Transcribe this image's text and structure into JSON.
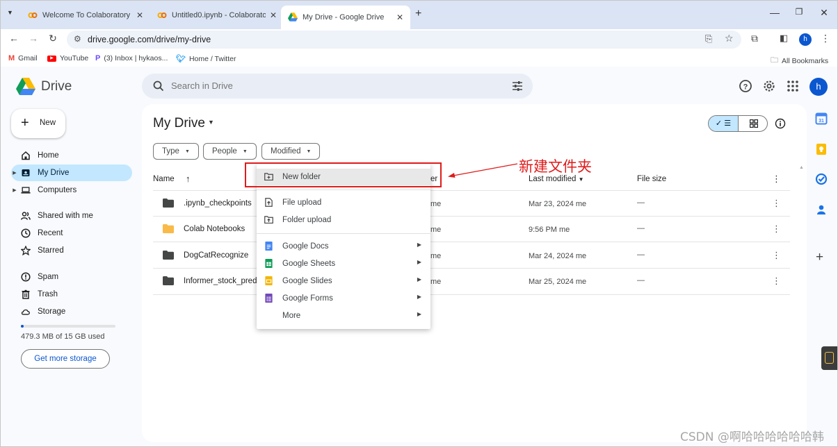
{
  "browser": {
    "tabs": [
      {
        "title": "Welcome To Colaboratory - C",
        "icon": "colab-icon",
        "active": false
      },
      {
        "title": "Untitled0.ipynb - Colaborato",
        "icon": "colab-icon",
        "active": false
      },
      {
        "title": "My Drive - Google Drive",
        "icon": "drive-icon",
        "active": true
      }
    ],
    "new_tab": "+",
    "url": "drive.google.com/drive/my-drive",
    "bookmarks": [
      {
        "label": "Gmail",
        "icon": "gmail-icon"
      },
      {
        "label": "YouTube",
        "icon": "youtube-icon"
      },
      {
        "label": "(3) Inbox | hykaos...",
        "icon": "proton-icon"
      },
      {
        "label": "Home / Twitter",
        "icon": "twitter-icon"
      }
    ],
    "all_bookmarks": "All Bookmarks",
    "profile_initial": "h"
  },
  "drive": {
    "logo_text": "Drive",
    "search_placeholder": "Search in Drive",
    "avatar_initial": "h",
    "new_button": "New",
    "nav": [
      {
        "label": "Home",
        "icon": "home-icon",
        "selected": false,
        "caret": false
      },
      {
        "label": "My Drive",
        "icon": "my-drive-icon",
        "selected": true,
        "caret": true
      },
      {
        "label": "Computers",
        "icon": "computers-icon",
        "selected": false,
        "caret": true
      },
      {
        "label": "Shared with me",
        "icon": "shared-icon",
        "selected": false,
        "caret": false
      },
      {
        "label": "Recent",
        "icon": "clock-icon",
        "selected": false,
        "caret": false
      },
      {
        "label": "Starred",
        "icon": "star-icon",
        "selected": false,
        "caret": false
      },
      {
        "label": "Spam",
        "icon": "spam-icon",
        "selected": false,
        "caret": false
      },
      {
        "label": "Trash",
        "icon": "trash-icon",
        "selected": false,
        "caret": false
      },
      {
        "label": "Storage",
        "icon": "cloud-icon",
        "selected": false,
        "caret": false
      }
    ],
    "storage_text": "479.3 MB of 15 GB used",
    "storage_fraction": 0.031,
    "get_storage": "Get more storage",
    "page_title": "My Drive",
    "filters": [
      "Type",
      "People",
      "Modified"
    ],
    "columns": {
      "name": "Name",
      "owner_suffix": "er",
      "modified": "Last modified",
      "size": "File size"
    },
    "files": [
      {
        "name": ".ipynb_checkpoints",
        "owner": "me",
        "modified": "Mar 23, 2024 me",
        "size": "—",
        "color": "#444746"
      },
      {
        "name": "Colab Notebooks",
        "owner": "me",
        "modified": "9:56 PM me",
        "size": "—",
        "color": "#f9ba48"
      },
      {
        "name": "DogCatRecognize",
        "owner": "me",
        "modified": "Mar 24, 2024 me",
        "size": "—",
        "color": "#444746"
      },
      {
        "name": "Informer_stock_prediction",
        "owner": "me",
        "modified": "Mar 25, 2024 me",
        "size": "—",
        "color": "#444746"
      }
    ]
  },
  "menu": {
    "items": [
      {
        "label": "New folder",
        "icon": "new-folder-icon",
        "submenu": false
      },
      {
        "label": "File upload",
        "icon": "file-upload-icon",
        "submenu": false
      },
      {
        "label": "Folder upload",
        "icon": "folder-upload-icon",
        "submenu": false
      },
      {
        "label": "Google Docs",
        "icon": "docs-icon",
        "submenu": true,
        "color": "#4285f4"
      },
      {
        "label": "Google Sheets",
        "icon": "sheets-icon",
        "submenu": true,
        "color": "#0f9d58"
      },
      {
        "label": "Google Slides",
        "icon": "slides-icon",
        "submenu": true,
        "color": "#f4b400"
      },
      {
        "label": "Google Forms",
        "icon": "forms-icon",
        "submenu": true,
        "color": "#7248b9"
      },
      {
        "label": "More",
        "icon": "",
        "submenu": true
      }
    ]
  },
  "annotation": {
    "text": "新建文件夹",
    "color": "#e01b1b"
  },
  "watermark": "CSDN @啊哈哈哈哈哈哈韩"
}
